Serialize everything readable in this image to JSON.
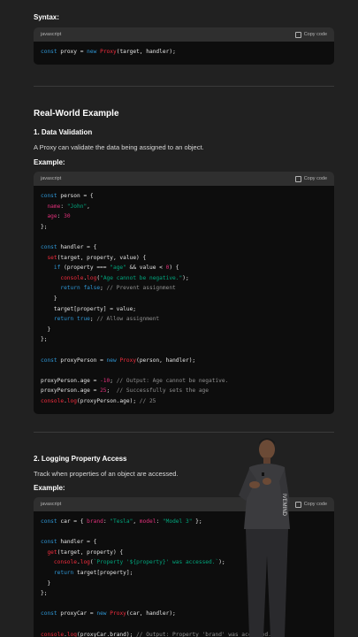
{
  "syntax_label": "Syntax:",
  "code_lang": "javascript",
  "copy_label": "Copy code",
  "syntax_code": "const proxy = new Proxy(target, handler);",
  "section_title": "Real-World Example",
  "sub1_title": "1. Data Validation",
  "sub1_desc": "A Proxy can validate the data being assigned to an object.",
  "example_label": "Example:",
  "sub2_title": "2. Logging Property Access",
  "sub2_desc": "Track when properties of an object are accessed.",
  "example2_label": "Example:",
  "code1_lines": [
    "const person = {",
    "  name: \"John\",",
    "  age: 30",
    "};",
    "",
    "const handler = {",
    "  set(target, property, value) {",
    "    if (property === \"age\" && value < 0) {",
    "      console.log(\"Age cannot be negative.\");",
    "      return false; // Prevent assignment",
    "    }",
    "    target[property] = value;",
    "    return true; // Allow assignment",
    "  }",
    "};",
    "",
    "const proxyPerson = new Proxy(person, handler);",
    "",
    "proxyPerson.age = -10; // Output: Age cannot be negative.",
    "proxyPerson.age = 25;  // Successfully sets the age",
    "console.log(proxyPerson.age); // 25"
  ],
  "code2_lines": [
    "const car = { brand: \"Tesla\", model: \"Model 3\" };",
    "",
    "const handler = {",
    "  get(target, property) {",
    "    console.log(`Property '${property}' was accessed.`);",
    "    return target[property];",
    "  }",
    "};",
    "",
    "const proxyCar = new Proxy(car, handler);",
    "",
    "console.log(proxyCar.brand); // Output: Property 'brand' was accessed. T"
  ]
}
